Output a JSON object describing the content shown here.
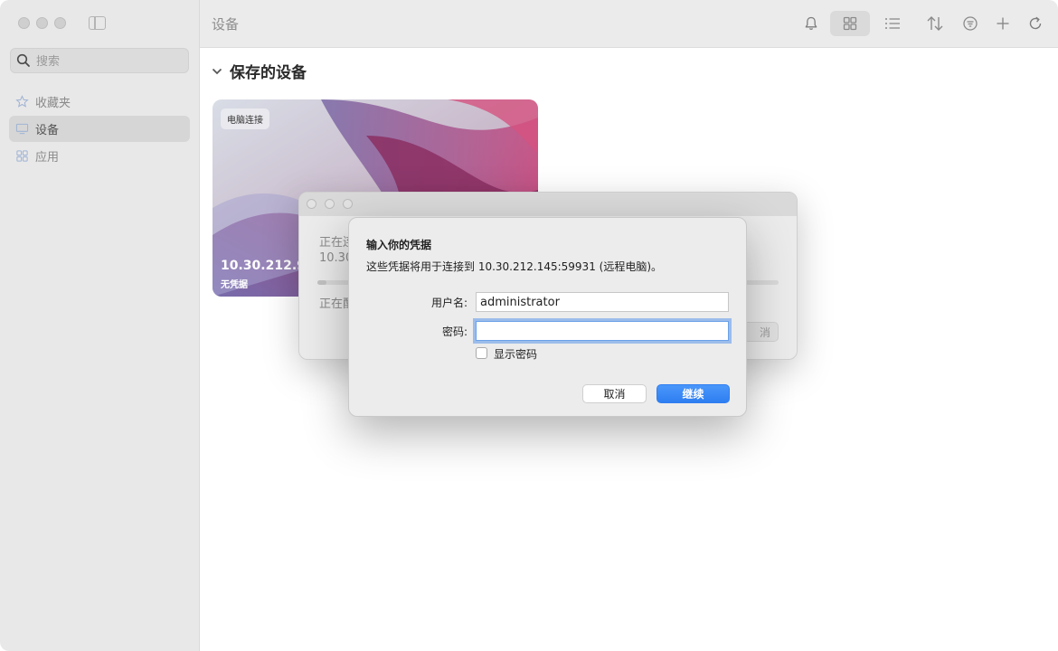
{
  "window": {
    "title": "设备"
  },
  "sidebar": {
    "search": {
      "placeholder": "搜索"
    },
    "items": [
      {
        "label": "收藏夹",
        "icon": "star-icon",
        "active": false
      },
      {
        "label": "设备",
        "icon": "monitor-icon",
        "active": true
      },
      {
        "label": "应用",
        "icon": "apps-grid-icon",
        "active": false
      }
    ]
  },
  "toolbar": {
    "title": "设备",
    "buttons": [
      "bell-icon",
      "grid-view-icon",
      "list-view-icon",
      "sort-icon",
      "filter-icon",
      "plus-icon",
      "refresh-icon"
    ]
  },
  "main": {
    "section_title": "保存的设备",
    "card": {
      "badge": "电脑连接",
      "host": "10.30.212.90",
      "subtitle": "无凭据"
    }
  },
  "progress_window": {
    "status_line1": "正在连",
    "status_line2": "10.30",
    "status_line3": "正在配",
    "cancel_label": "消",
    "progress_percent": 2
  },
  "dialog": {
    "title": "输入你的凭据",
    "message": "这些凭据将用于连接到 10.30.212.145:59931 (远程电脑)。",
    "username_label": "用户名:",
    "username_value": "administrator",
    "password_label": "密码:",
    "password_value": "",
    "show_password_label": "显示密码",
    "cancel_label": "取消",
    "continue_label": "继续"
  },
  "colors": {
    "accent": "#2f7ef1",
    "sidebar_bg": "#e9e8e8",
    "toolbar_bg": "#ebebeb"
  }
}
